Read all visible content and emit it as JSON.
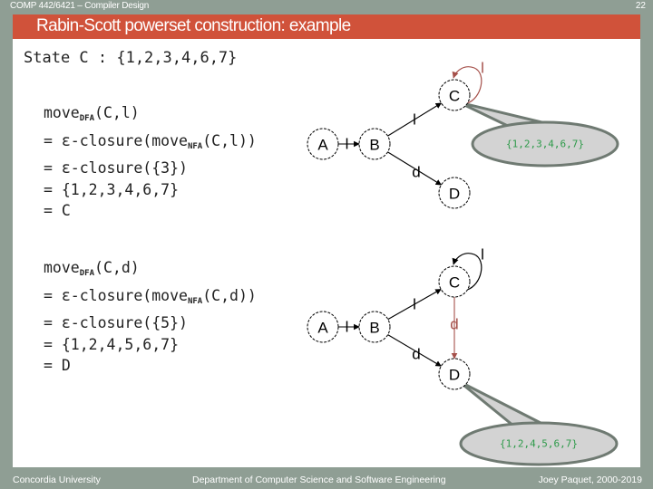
{
  "header": {
    "course": "COMP 442/6421 – Compiler Design",
    "page_number": "22",
    "title": "Rabin-Scott powerset construction: example"
  },
  "state_line": "State C : {1,2,3,4,6,7}",
  "derivations": [
    {
      "symbol": "l",
      "lines": [
        {
          "pre": "move",
          "sub": "DFA",
          "post": "(C,l)"
        },
        {
          "pre": "= ε-closure(move",
          "sub": "NFA",
          "post": "(C,l))"
        },
        {
          "pre": "= ε-closure({3})",
          "sub": "",
          "post": ""
        },
        {
          "pre": "= {1,2,3,4,6,7}",
          "sub": "",
          "post": ""
        },
        {
          "pre": "= C",
          "sub": "",
          "post": ""
        }
      ]
    },
    {
      "symbol": "d",
      "lines": [
        {
          "pre": "move",
          "sub": "DFA",
          "post": "(C,d)"
        },
        {
          "pre": "= ε-closure(move",
          "sub": "NFA",
          "post": "(C,d))"
        },
        {
          "pre": "= ε-closure({5})",
          "sub": "",
          "post": ""
        },
        {
          "pre": "= {1,2,4,5,6,7}",
          "sub": "",
          "post": ""
        },
        {
          "pre": "= D",
          "sub": "",
          "post": ""
        }
      ]
    }
  ],
  "diagrams": [
    {
      "states": [
        "A",
        "B",
        "C",
        "D"
      ],
      "edges": [
        {
          "from": "A",
          "to": "B",
          "label": "l",
          "highlight": false
        },
        {
          "from": "B",
          "to": "C",
          "label": "l",
          "highlight": false
        },
        {
          "from": "B",
          "to": "D",
          "label": "d",
          "highlight": false
        },
        {
          "from": "C",
          "to": "C",
          "label": "l",
          "highlight": true
        }
      ],
      "callout": {
        "target": "C",
        "text": "{1,2,3,4,6,7}"
      }
    },
    {
      "states": [
        "A",
        "B",
        "C",
        "D"
      ],
      "edges": [
        {
          "from": "A",
          "to": "B",
          "label": "l",
          "highlight": false
        },
        {
          "from": "B",
          "to": "C",
          "label": "l",
          "highlight": false
        },
        {
          "from": "B",
          "to": "D",
          "label": "d",
          "highlight": false
        },
        {
          "from": "C",
          "to": "C",
          "label": "l",
          "highlight": false
        },
        {
          "from": "C",
          "to": "D",
          "label": "d",
          "highlight": true
        }
      ],
      "callout": {
        "target": "D",
        "text": "{1,2,4,5,6,7}"
      }
    }
  ],
  "colors": {
    "background": "#8f9e94",
    "banner": "#d0523a",
    "highlight_edge": "#a5504a",
    "callout_fill": "#d3d3d3",
    "callout_stroke": "#6f7a72",
    "callout_text": "#2e9a4a"
  },
  "footer": {
    "left": "Concordia University",
    "center": "Department of Computer Science and Software Engineering",
    "right": "Joey Paquet, 2000-2019"
  }
}
